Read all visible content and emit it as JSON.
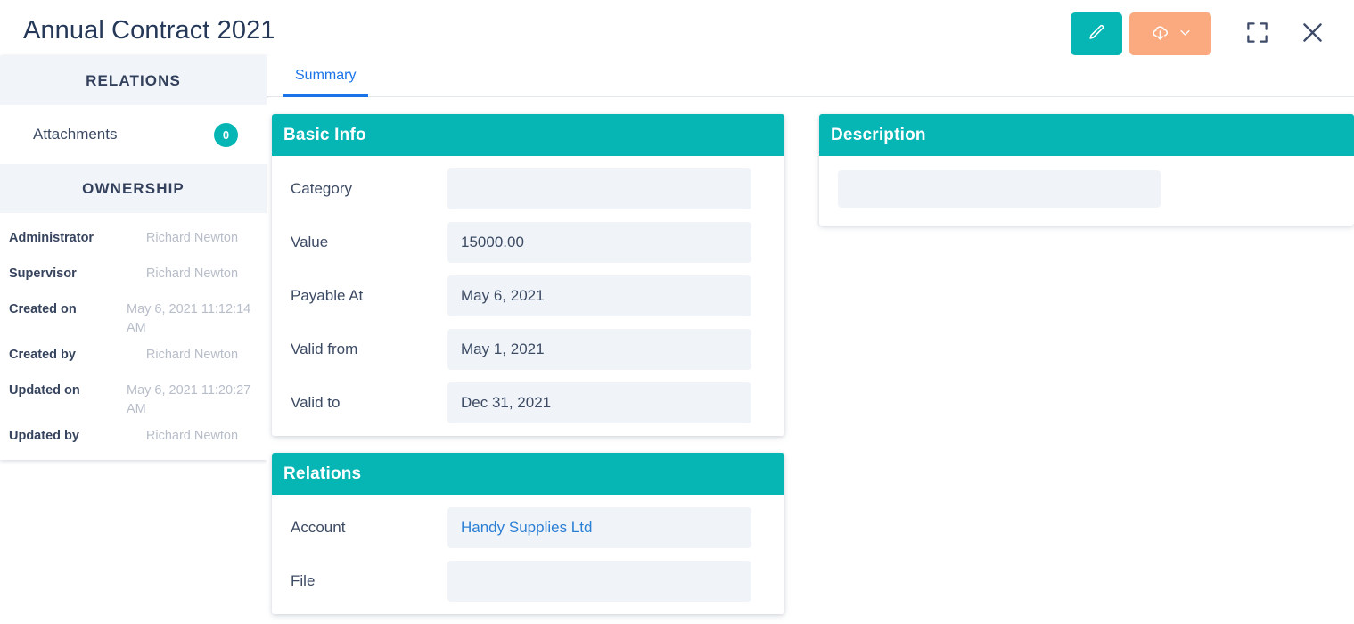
{
  "header": {
    "title": "Annual Contract 2021",
    "actions": [
      {
        "name": "edit-button",
        "icon": "pencil-icon",
        "color": "#06b6b4"
      },
      {
        "name": "download-button",
        "icon": "cloud-download-icon",
        "color": "#fba97e"
      },
      {
        "name": "fullscreen-button",
        "icon": "fullscreen-icon",
        "color": "#3d4a68"
      },
      {
        "name": "close-button",
        "icon": "close-icon",
        "color": "#3d4a68"
      }
    ]
  },
  "sidebar": {
    "relations_header": "RELATIONS",
    "attachments_label": "Attachments",
    "attachments_count": "0",
    "ownership_header": "OWNERSHIP",
    "ownership_rows": [
      {
        "key": "Administrator",
        "value": "Richard Newton",
        "multiline": false
      },
      {
        "key": "Supervisor",
        "value": "Richard Newton",
        "multiline": false
      },
      {
        "key": "Created on",
        "value": "May 6, 2021 11:12:14 AM",
        "multiline": true
      },
      {
        "key": "Created by",
        "value": "Richard Newton",
        "multiline": false
      },
      {
        "key": "Updated on",
        "value": "May 6, 2021 11:20:27 AM",
        "multiline": true
      },
      {
        "key": "Updated by",
        "value": "Richard Newton",
        "multiline": false
      }
    ]
  },
  "tabs": [
    {
      "label": "Summary",
      "active": true
    }
  ],
  "cards": {
    "basic_info": {
      "title": "Basic Info",
      "fields": [
        {
          "label": "Category",
          "value": ""
        },
        {
          "label": "Value",
          "value": "15000.00"
        },
        {
          "label": "Payable At",
          "value": "May 6, 2021"
        },
        {
          "label": "Valid from",
          "value": "May 1, 2021"
        },
        {
          "label": "Valid to",
          "value": "Dec 31, 2021"
        }
      ]
    },
    "relations": {
      "title": "Relations",
      "fields": [
        {
          "label": "Account",
          "value": "Handy Supplies Ltd",
          "is_link": true
        },
        {
          "label": "File",
          "value": "",
          "is_link": false
        }
      ]
    },
    "description": {
      "title": "Description",
      "fields": [
        {
          "label": "",
          "value": ""
        }
      ]
    }
  },
  "colors": {
    "accent_teal": "#06b6b4",
    "accent_orange": "#fba97e",
    "link_blue": "#2b7fd4",
    "tab_blue": "#1a73e8",
    "field_bg": "#f0f4f8",
    "section_bg": "#f1f5f9",
    "text_dark": "#34415c",
    "text_muted": "#b7bdc9"
  }
}
